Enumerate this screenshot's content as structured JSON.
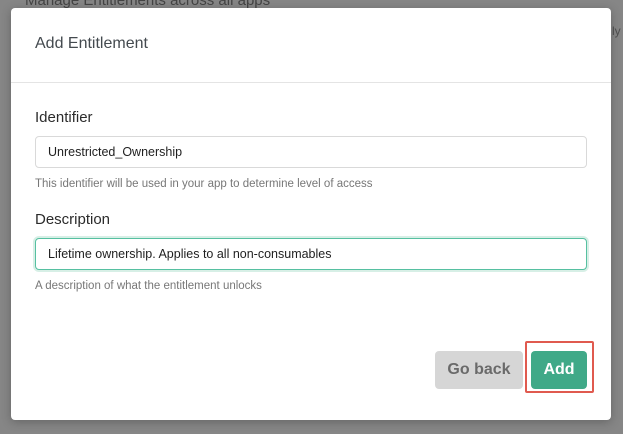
{
  "background": {
    "page_header_text": "Manage Entitlements across all apps",
    "right_edge_text": "ly"
  },
  "modal": {
    "title": "Add Entitlement",
    "identifier": {
      "label": "Identifier",
      "value": "Unrestricted_Ownership",
      "hint": "This identifier will be used in your app to determine level of access"
    },
    "description": {
      "label": "Description",
      "value": "Lifetime ownership. Applies to all non-consumables",
      "hint": "A description of what the entitlement unlocks"
    },
    "buttons": {
      "back_label": "Go back",
      "add_label": "Add"
    }
  },
  "colors": {
    "accent": "#40a988",
    "focus_border": "#56c0a1",
    "highlight": "#e05a4f",
    "secondary_button": "#d6d6d6"
  }
}
